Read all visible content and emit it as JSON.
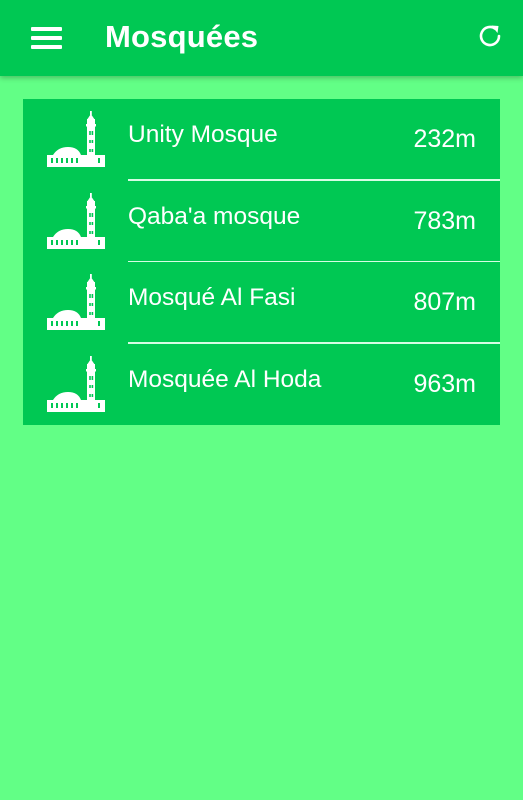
{
  "appbar": {
    "title": "Mosquées",
    "menu_icon": "menu-icon",
    "refresh_icon": "refresh-icon"
  },
  "colors": {
    "appbar": "#00C853",
    "background": "#62FF86",
    "list_background": "#00C853",
    "text": "#FFFFFF"
  },
  "mosques": [
    {
      "name": "Unity Mosque",
      "distance": "232m",
      "icon": "mosque-icon"
    },
    {
      "name": "Qaba'a mosque",
      "distance": "783m",
      "icon": "mosque-icon"
    },
    {
      "name": "Mosqué Al Fasi",
      "distance": "807m",
      "icon": "mosque-icon"
    },
    {
      "name": "Mosquée Al Hoda",
      "distance": "963m",
      "icon": "mosque-icon"
    }
  ]
}
